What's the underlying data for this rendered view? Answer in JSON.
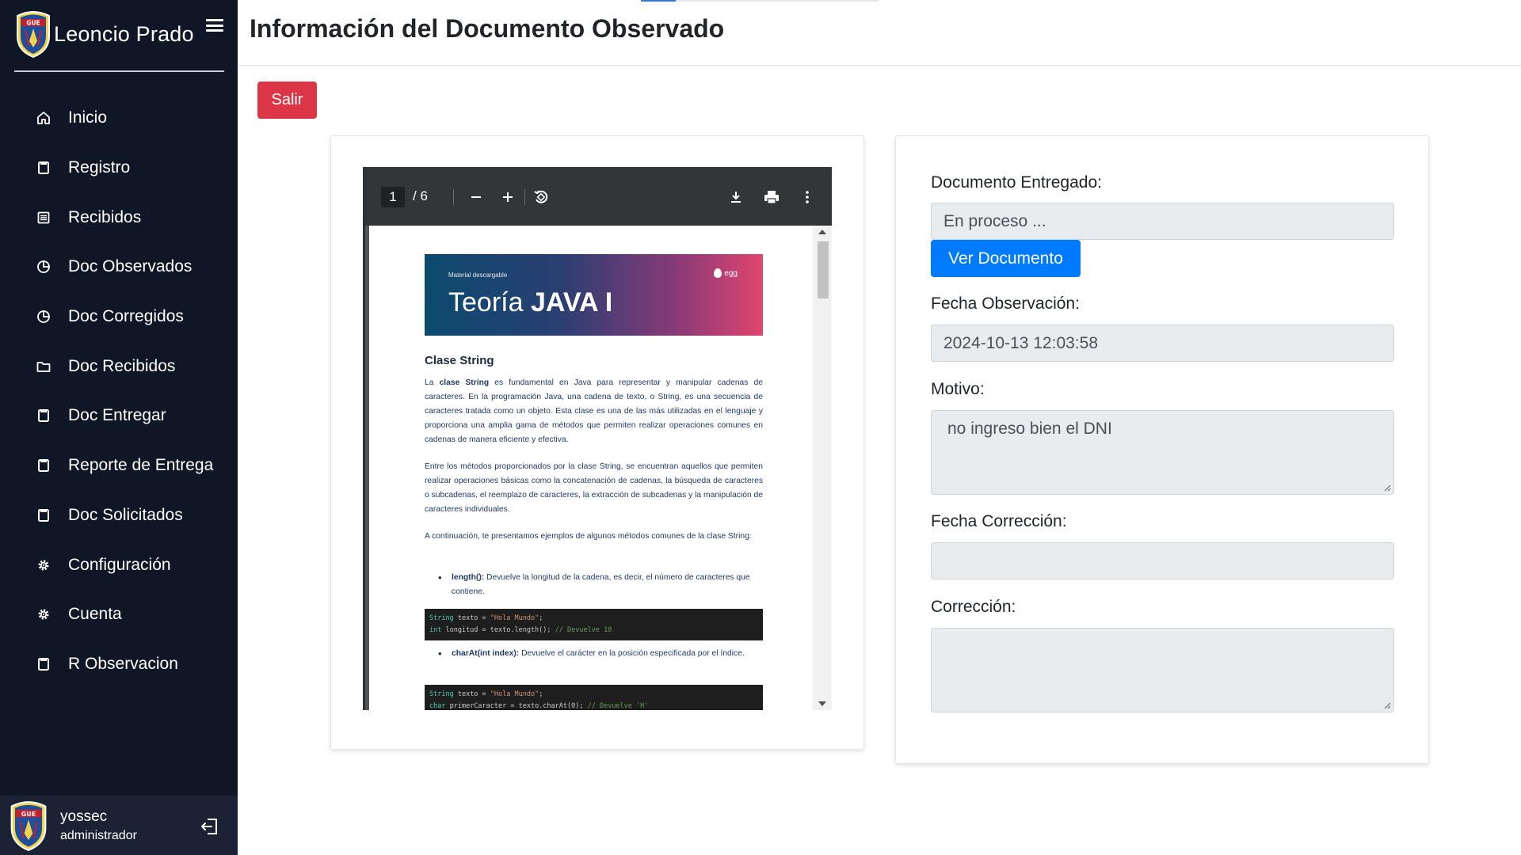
{
  "sidebar": {
    "brand_title": "Leoncio Prado",
    "logo_text": "GUE",
    "items": [
      {
        "label": "Inicio",
        "icon": "home-icon"
      },
      {
        "label": "Registro",
        "icon": "file-icon"
      },
      {
        "label": "Recibidos",
        "icon": "list-icon"
      },
      {
        "label": "Doc Observados",
        "icon": "chart-pie-icon"
      },
      {
        "label": "Doc Corregidos",
        "icon": "chart-pie-icon"
      },
      {
        "label": "Doc Recibidos",
        "icon": "folder-icon"
      },
      {
        "label": "Doc Entregar",
        "icon": "file-icon"
      },
      {
        "label": "Reporte de Entrega",
        "icon": "file-icon"
      },
      {
        "label": "Doc Solicitados",
        "icon": "file-icon"
      },
      {
        "label": "Configuración",
        "icon": "gear-icon"
      },
      {
        "label": "Cuenta",
        "icon": "gear-icon"
      },
      {
        "label": "R Observacion",
        "icon": "file-icon"
      }
    ],
    "user": {
      "name": "yossec",
      "role": "administrador"
    }
  },
  "header": {
    "title": "Información del Documento Observado"
  },
  "actions": {
    "exit_label": "Salir"
  },
  "pdf_viewer": {
    "current_page": "1",
    "total_pages": "/ 6",
    "document": {
      "banner_subtitle": "Material descargable",
      "banner_title_light": "Teoría ",
      "banner_title_bold": "JAVA I",
      "banner_logo": "egg",
      "heading": "Clase String",
      "para1_prefix": "La ",
      "para1_bold": "clase String",
      "para1_rest": " es fundamental en Java para representar y manipular cadenas de caracteres. En la programación Java, una cadena de texto, o String, es una secuencia de caracteres tratada como un objeto. Esta clase es una de las más utilizadas en el lenguaje y proporciona una amplia gama de métodos que permiten realizar operaciones comunes en cadenas de manera eficiente y efectiva.",
      "para2": "Entre los métodos proporcionados por la clase String, se encuentran aquellos que permiten realizar operaciones básicas como la concatenación de cadenas, la búsqueda de caracteres o subcadenas, el reemplazo de caracteres, la extracción de subcadenas y la manipulación de caracteres individuales.",
      "para3": "A continuación, te presentamos ejemplos de algunos métodos comunes de la clase String:",
      "bullet1_bold": "length():",
      "bullet1_text": " Devuelve la longitud de la cadena, es decir, el número de caracteres que contiene.",
      "code1_line1_a": "String",
      "code1_line1_b": " texto = ",
      "code1_line1_c": "\"Hola Mundo\"",
      "code1_line1_d": ";",
      "code1_line2_a": "int",
      "code1_line2_b": " longitud = texto.length(); ",
      "code1_line2_c": "// Devuelve 10",
      "bullet2_bold": "charAt(int index):",
      "bullet2_text": " Devuelve el carácter en la posición especificada por el índice.",
      "code2_line1_a": "String",
      "code2_line1_b": " texto = ",
      "code2_line1_c": "\"Hola Mundo\"",
      "code2_line1_d": ";",
      "code2_line2_a": "char",
      "code2_line2_b": " primerCaracter = texto.charAt(0); ",
      "code2_line2_c": "// Devuelve 'H'"
    }
  },
  "form": {
    "doc_delivered_label": "Documento Entregado:",
    "doc_delivered_value": "En proceso ...",
    "view_doc_label": "Ver Documento",
    "obs_date_label": "Fecha Observación:",
    "obs_date_value": "2024-10-13 12:03:58",
    "reason_label": "Motivo:",
    "reason_value": "no ingreso bien el DNI",
    "corr_date_label": "Fecha Corrección:",
    "corr_date_value": "",
    "correction_label": "Corrección:",
    "correction_value": ""
  },
  "colors": {
    "sidebar_bg": "#0f1726",
    "danger": "#dc3545",
    "primary": "#007bff",
    "input_bg": "#e9ecef"
  }
}
